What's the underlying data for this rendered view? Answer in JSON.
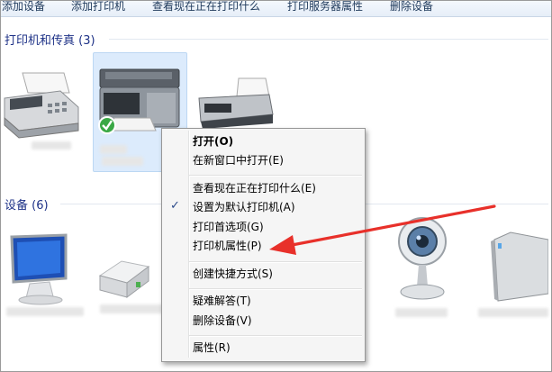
{
  "toolbar": {
    "add_device": "添加设备",
    "add_printer": "添加打印机",
    "see_printing": "查看现在正在打印什么",
    "print_server_properties": "打印服务器属性",
    "remove_device": "删除设备"
  },
  "groups": {
    "printers": "打印机和传真 (3)",
    "devices": "设备 (6)"
  },
  "context_menu": {
    "open": "打开(O)",
    "open_new_window": "在新窗口中打开(E)",
    "see_printing": "查看现在正在打印什么(E)",
    "set_default": "设置为默认打印机(A)",
    "printing_preferences": "打印首选项(G)",
    "printer_properties": "打印机属性(P)",
    "create_shortcut": "创建快捷方式(S)",
    "troubleshoot": "疑难解答(T)",
    "remove_device": "删除设备(V)",
    "properties": "属性(R)",
    "checked_item": "set_default"
  },
  "colors": {
    "annotation_arrow": "#e8302a",
    "group_header": "#1e3287",
    "selection": "#dcebfc"
  }
}
